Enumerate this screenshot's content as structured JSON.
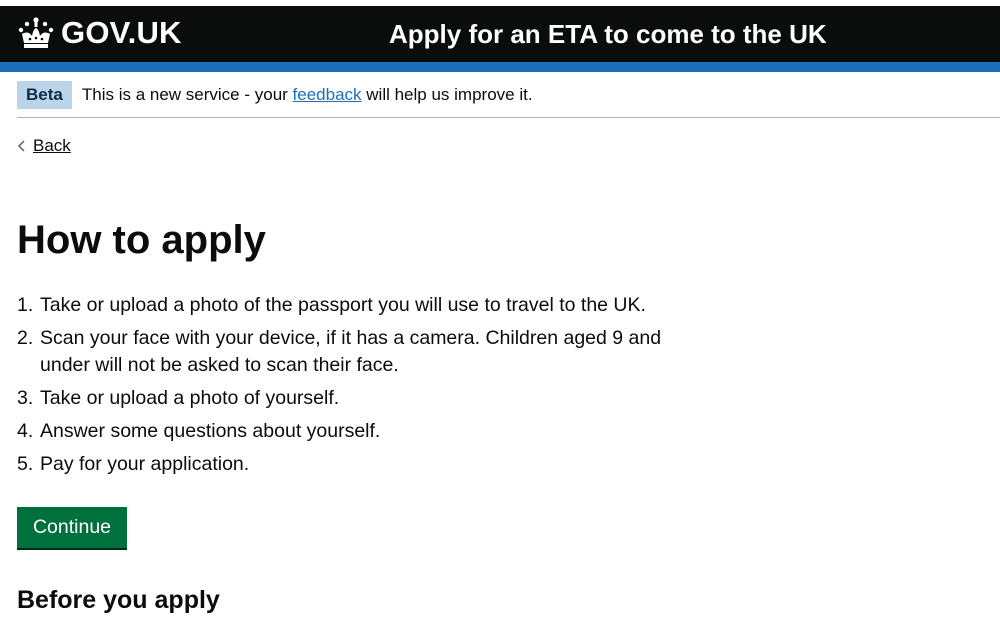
{
  "header": {
    "logo_text": "GOV.UK",
    "service_name": "Apply for an ETA to come to the UK",
    "logo_icon": "crown-icon",
    "background_color": "#0b0c0c",
    "accent_color": "#1d70b8"
  },
  "phase_banner": {
    "tag": "Beta",
    "text_before": "This is a new service - your ",
    "link_text": "feedback",
    "text_after": " will help us improve it."
  },
  "back_link": {
    "icon": "chevron-left-icon",
    "label": "Back"
  },
  "main": {
    "title": "How to apply",
    "steps": [
      {
        "number": "1.",
        "text": "Take or upload a photo of the passport you will use to travel to the UK."
      },
      {
        "number": "2.",
        "text": "Scan your face with your device, if it has a camera. Children aged 9 and under will not be asked to scan their face."
      },
      {
        "number": "3.",
        "text": "Take or upload a photo of yourself."
      },
      {
        "number": "4.",
        "text": "Answer some questions about yourself."
      },
      {
        "number": "5.",
        "text": "Pay for your application."
      }
    ],
    "continue_label": "Continue",
    "continue_color": "#00703c",
    "next_heading": "Before you apply"
  }
}
